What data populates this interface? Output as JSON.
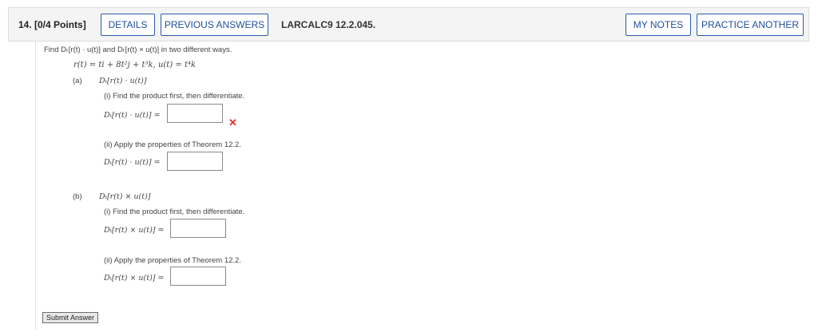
{
  "header": {
    "question_number": "14. [0/4 Points]",
    "details_label": "DETAILS",
    "previous_answers_label": "PREVIOUS ANSWERS",
    "problem_code": "LARCALC9 12.2.045.",
    "my_notes_label": "MY NOTES",
    "practice_another_label": "PRACTICE ANOTHER"
  },
  "problem": {
    "instruction": "Find Dₜ[r(t) · u(t)] and Dₜ[r(t) × u(t)] in two different ways.",
    "given": "r(t) = ti + 8t²j + t³k,   u(t) = t⁴k",
    "part_a": {
      "label": "(a)",
      "heading": "Dₜ[r(t) · u(t)]",
      "step1_text": "(i) Find the product first, then differentiate.",
      "step1_expr": "Dₜ[r(t) · u(t)] =",
      "step1_value": "",
      "step1_status": "incorrect",
      "step2_text": "(ii) Apply the properties of Theorem 12.2.",
      "step2_expr": "Dₜ[r(t) · u(t)] =",
      "step2_value": ""
    },
    "part_b": {
      "label": "(b)",
      "heading": "Dₜ[r(t) × u(t)]",
      "step1_text": "(i) Find the product first, then differentiate.",
      "step1_expr": "Dₜ[r(t) × u(t)] =",
      "step1_value": "",
      "step2_text": "(ii) Apply the properties of Theorem 12.2.",
      "step2_expr": "Dₜ[r(t) × u(t)] =",
      "step2_value": ""
    }
  },
  "submit_label": "Submit Answer",
  "colors": {
    "accent": "#2b5aa8",
    "error": "#d9302c",
    "header_bg": "#f4f4f4"
  }
}
